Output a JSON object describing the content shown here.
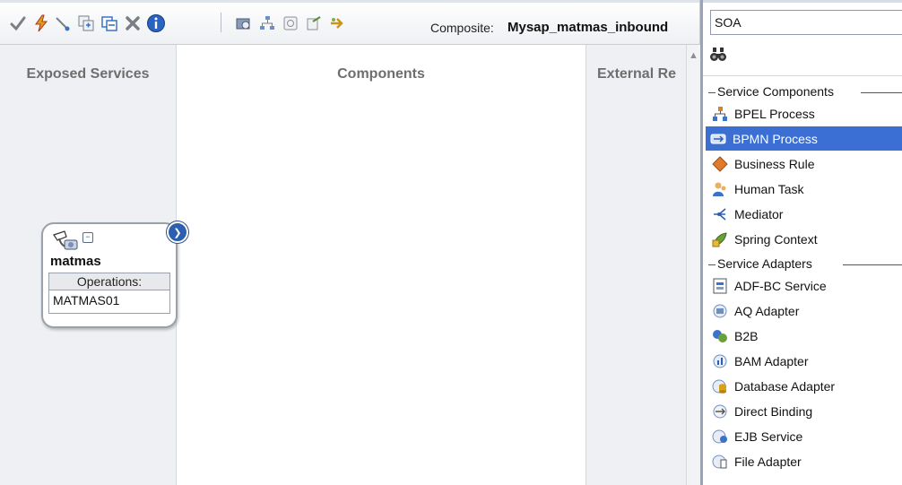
{
  "toolbar": {
    "icons": [
      "validate-icon",
      "lightning-icon",
      "wire-icon",
      "copy-icon",
      "paste-icon",
      "delete-icon",
      "info-icon",
      "deploy-icon",
      "layout-icon",
      "test-icon",
      "publish-icon",
      "arrow-icon"
    ],
    "composite_label": "Composite:",
    "composite_name": "Mysap_matmas_inbound"
  },
  "swimlanes": {
    "exposed": "Exposed Services",
    "components": "Components",
    "external": "External Re"
  },
  "service": {
    "name": "matmas",
    "operations_header": "Operations:",
    "operation": "MATMAS01"
  },
  "palette": {
    "dropdown_value": "SOA",
    "search_placeholder": "",
    "sections": [
      {
        "title": "Service Components",
        "items": [
          {
            "label": "BPEL Process",
            "icon": "bpel-icon"
          },
          {
            "label": "BPMN Process",
            "icon": "bpmn-icon",
            "selected": true
          },
          {
            "label": "Business Rule",
            "icon": "business-rule-icon"
          },
          {
            "label": "Human Task",
            "icon": "human-task-icon"
          },
          {
            "label": "Mediator",
            "icon": "mediator-icon"
          },
          {
            "label": "Spring Context",
            "icon": "spring-icon"
          }
        ]
      },
      {
        "title": "Service Adapters",
        "items": [
          {
            "label": "ADF-BC Service",
            "icon": "adf-bc-icon"
          },
          {
            "label": "AQ Adapter",
            "icon": "aq-adapter-icon"
          },
          {
            "label": "B2B",
            "icon": "b2b-icon"
          },
          {
            "label": "BAM Adapter",
            "icon": "bam-adapter-icon"
          },
          {
            "label": "Database Adapter",
            "icon": "database-adapter-icon"
          },
          {
            "label": "Direct Binding",
            "icon": "direct-binding-icon"
          },
          {
            "label": "EJB Service",
            "icon": "ejb-service-icon"
          },
          {
            "label": "File Adapter",
            "icon": "file-adapter-icon"
          }
        ]
      }
    ]
  },
  "colors": {
    "selection": "#3b6fd4",
    "lane_title": "#6e6e6e",
    "node_border": "#9aa1aa"
  }
}
